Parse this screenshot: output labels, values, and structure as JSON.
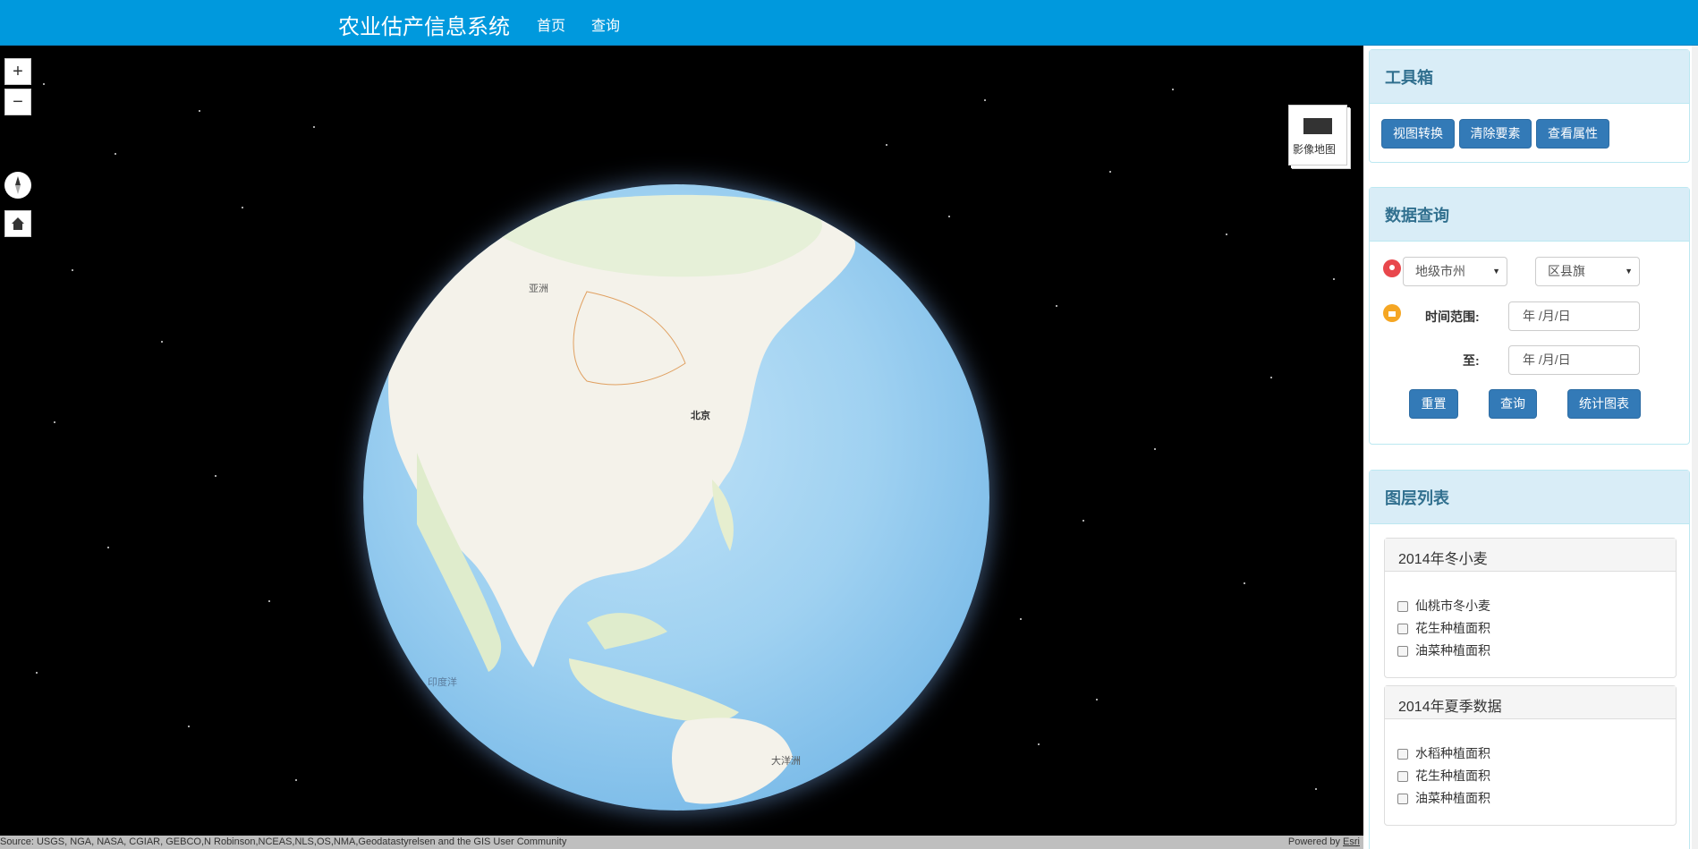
{
  "header": {
    "brand": "农业估产信息系统",
    "nav": [
      "首页",
      "查询"
    ]
  },
  "map": {
    "controls": {
      "zoom_in": "+",
      "zoom_out": "−"
    },
    "basemap_label": "影像地图",
    "map_labels": {
      "asia": "亚洲",
      "beijing": "北京",
      "indian_ocean": "印度洋",
      "oceania": "大洋洲"
    },
    "attribution": "Source: USGS, NGA, NASA, CGIAR, GEBCO,N Robinson,NCEAS,NLS,OS,NMA,Geodatastyrelsen and the GIS User Community",
    "powered_by": "Powered by ",
    "esri": "Esri"
  },
  "toolbox": {
    "title": "工具箱",
    "buttons": [
      "视图转换",
      "清除要素",
      "查看属性"
    ]
  },
  "query": {
    "title": "数据查询",
    "city_select": "地级市州",
    "county_select": "区县旗",
    "time_label": "时间范围:",
    "to_label": "至:",
    "date_placeholder": "年 /月/日",
    "buttons": [
      "重置",
      "查询",
      "统计图表"
    ]
  },
  "layers": {
    "title": "图层列表",
    "groups": [
      {
        "title": "2014年冬小麦",
        "items": [
          "仙桃市冬小麦",
          "花生种植面积",
          "油菜种植面积"
        ]
      },
      {
        "title": "2014年夏季数据",
        "items": [
          "水稻种植面积",
          "花生种植面积",
          "油菜种植面积"
        ]
      }
    ]
  },
  "colors": {
    "header": "#0099dd",
    "primary": "#337ab7",
    "panel_head": "#d9edf7",
    "pin_red": "#e8474c",
    "pin_orange": "#f5a623"
  }
}
